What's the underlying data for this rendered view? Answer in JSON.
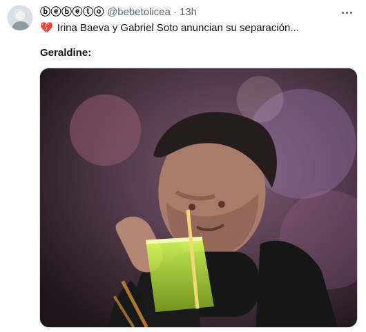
{
  "tweet": {
    "display_name": "ⓑⓔⓑⓔⓣⓞ",
    "handle": "@bebetolicea",
    "separator": "·",
    "time": "13h",
    "text_icon": "broken-heart-icon",
    "text": "Irina Baeva y Gabriel Soto anuncian su separación...",
    "label": "Geraldine:",
    "media_description": "man-drinking-from-cup"
  },
  "icons": {
    "avatar": "avatar-icon",
    "more": "more-options-icon"
  },
  "colors": {
    "name": "#0f1419",
    "secondary": "#536471",
    "heart": "#d62839",
    "border": "#cfd9de"
  }
}
